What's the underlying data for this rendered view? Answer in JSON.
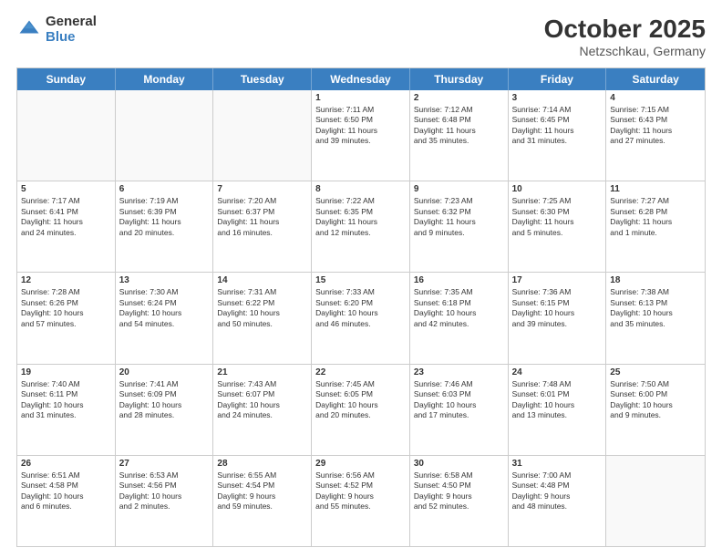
{
  "logo": {
    "general": "General",
    "blue": "Blue"
  },
  "header": {
    "month": "October 2025",
    "location": "Netzschkau, Germany"
  },
  "weekdays": [
    "Sunday",
    "Monday",
    "Tuesday",
    "Wednesday",
    "Thursday",
    "Friday",
    "Saturday"
  ],
  "rows": [
    [
      {
        "day": "",
        "info": ""
      },
      {
        "day": "",
        "info": ""
      },
      {
        "day": "",
        "info": ""
      },
      {
        "day": "1",
        "info": "Sunrise: 7:11 AM\nSunset: 6:50 PM\nDaylight: 11 hours\nand 39 minutes."
      },
      {
        "day": "2",
        "info": "Sunrise: 7:12 AM\nSunset: 6:48 PM\nDaylight: 11 hours\nand 35 minutes."
      },
      {
        "day": "3",
        "info": "Sunrise: 7:14 AM\nSunset: 6:45 PM\nDaylight: 11 hours\nand 31 minutes."
      },
      {
        "day": "4",
        "info": "Sunrise: 7:15 AM\nSunset: 6:43 PM\nDaylight: 11 hours\nand 27 minutes."
      }
    ],
    [
      {
        "day": "5",
        "info": "Sunrise: 7:17 AM\nSunset: 6:41 PM\nDaylight: 11 hours\nand 24 minutes."
      },
      {
        "day": "6",
        "info": "Sunrise: 7:19 AM\nSunset: 6:39 PM\nDaylight: 11 hours\nand 20 minutes."
      },
      {
        "day": "7",
        "info": "Sunrise: 7:20 AM\nSunset: 6:37 PM\nDaylight: 11 hours\nand 16 minutes."
      },
      {
        "day": "8",
        "info": "Sunrise: 7:22 AM\nSunset: 6:35 PM\nDaylight: 11 hours\nand 12 minutes."
      },
      {
        "day": "9",
        "info": "Sunrise: 7:23 AM\nSunset: 6:32 PM\nDaylight: 11 hours\nand 9 minutes."
      },
      {
        "day": "10",
        "info": "Sunrise: 7:25 AM\nSunset: 6:30 PM\nDaylight: 11 hours\nand 5 minutes."
      },
      {
        "day": "11",
        "info": "Sunrise: 7:27 AM\nSunset: 6:28 PM\nDaylight: 11 hours\nand 1 minute."
      }
    ],
    [
      {
        "day": "12",
        "info": "Sunrise: 7:28 AM\nSunset: 6:26 PM\nDaylight: 10 hours\nand 57 minutes."
      },
      {
        "day": "13",
        "info": "Sunrise: 7:30 AM\nSunset: 6:24 PM\nDaylight: 10 hours\nand 54 minutes."
      },
      {
        "day": "14",
        "info": "Sunrise: 7:31 AM\nSunset: 6:22 PM\nDaylight: 10 hours\nand 50 minutes."
      },
      {
        "day": "15",
        "info": "Sunrise: 7:33 AM\nSunset: 6:20 PM\nDaylight: 10 hours\nand 46 minutes."
      },
      {
        "day": "16",
        "info": "Sunrise: 7:35 AM\nSunset: 6:18 PM\nDaylight: 10 hours\nand 42 minutes."
      },
      {
        "day": "17",
        "info": "Sunrise: 7:36 AM\nSunset: 6:15 PM\nDaylight: 10 hours\nand 39 minutes."
      },
      {
        "day": "18",
        "info": "Sunrise: 7:38 AM\nSunset: 6:13 PM\nDaylight: 10 hours\nand 35 minutes."
      }
    ],
    [
      {
        "day": "19",
        "info": "Sunrise: 7:40 AM\nSunset: 6:11 PM\nDaylight: 10 hours\nand 31 minutes."
      },
      {
        "day": "20",
        "info": "Sunrise: 7:41 AM\nSunset: 6:09 PM\nDaylight: 10 hours\nand 28 minutes."
      },
      {
        "day": "21",
        "info": "Sunrise: 7:43 AM\nSunset: 6:07 PM\nDaylight: 10 hours\nand 24 minutes."
      },
      {
        "day": "22",
        "info": "Sunrise: 7:45 AM\nSunset: 6:05 PM\nDaylight: 10 hours\nand 20 minutes."
      },
      {
        "day": "23",
        "info": "Sunrise: 7:46 AM\nSunset: 6:03 PM\nDaylight: 10 hours\nand 17 minutes."
      },
      {
        "day": "24",
        "info": "Sunrise: 7:48 AM\nSunset: 6:01 PM\nDaylight: 10 hours\nand 13 minutes."
      },
      {
        "day": "25",
        "info": "Sunrise: 7:50 AM\nSunset: 6:00 PM\nDaylight: 10 hours\nand 9 minutes."
      }
    ],
    [
      {
        "day": "26",
        "info": "Sunrise: 6:51 AM\nSunset: 4:58 PM\nDaylight: 10 hours\nand 6 minutes."
      },
      {
        "day": "27",
        "info": "Sunrise: 6:53 AM\nSunset: 4:56 PM\nDaylight: 10 hours\nand 2 minutes."
      },
      {
        "day": "28",
        "info": "Sunrise: 6:55 AM\nSunset: 4:54 PM\nDaylight: 9 hours\nand 59 minutes."
      },
      {
        "day": "29",
        "info": "Sunrise: 6:56 AM\nSunset: 4:52 PM\nDaylight: 9 hours\nand 55 minutes."
      },
      {
        "day": "30",
        "info": "Sunrise: 6:58 AM\nSunset: 4:50 PM\nDaylight: 9 hours\nand 52 minutes."
      },
      {
        "day": "31",
        "info": "Sunrise: 7:00 AM\nSunset: 4:48 PM\nDaylight: 9 hours\nand 48 minutes."
      },
      {
        "day": "",
        "info": ""
      }
    ]
  ]
}
